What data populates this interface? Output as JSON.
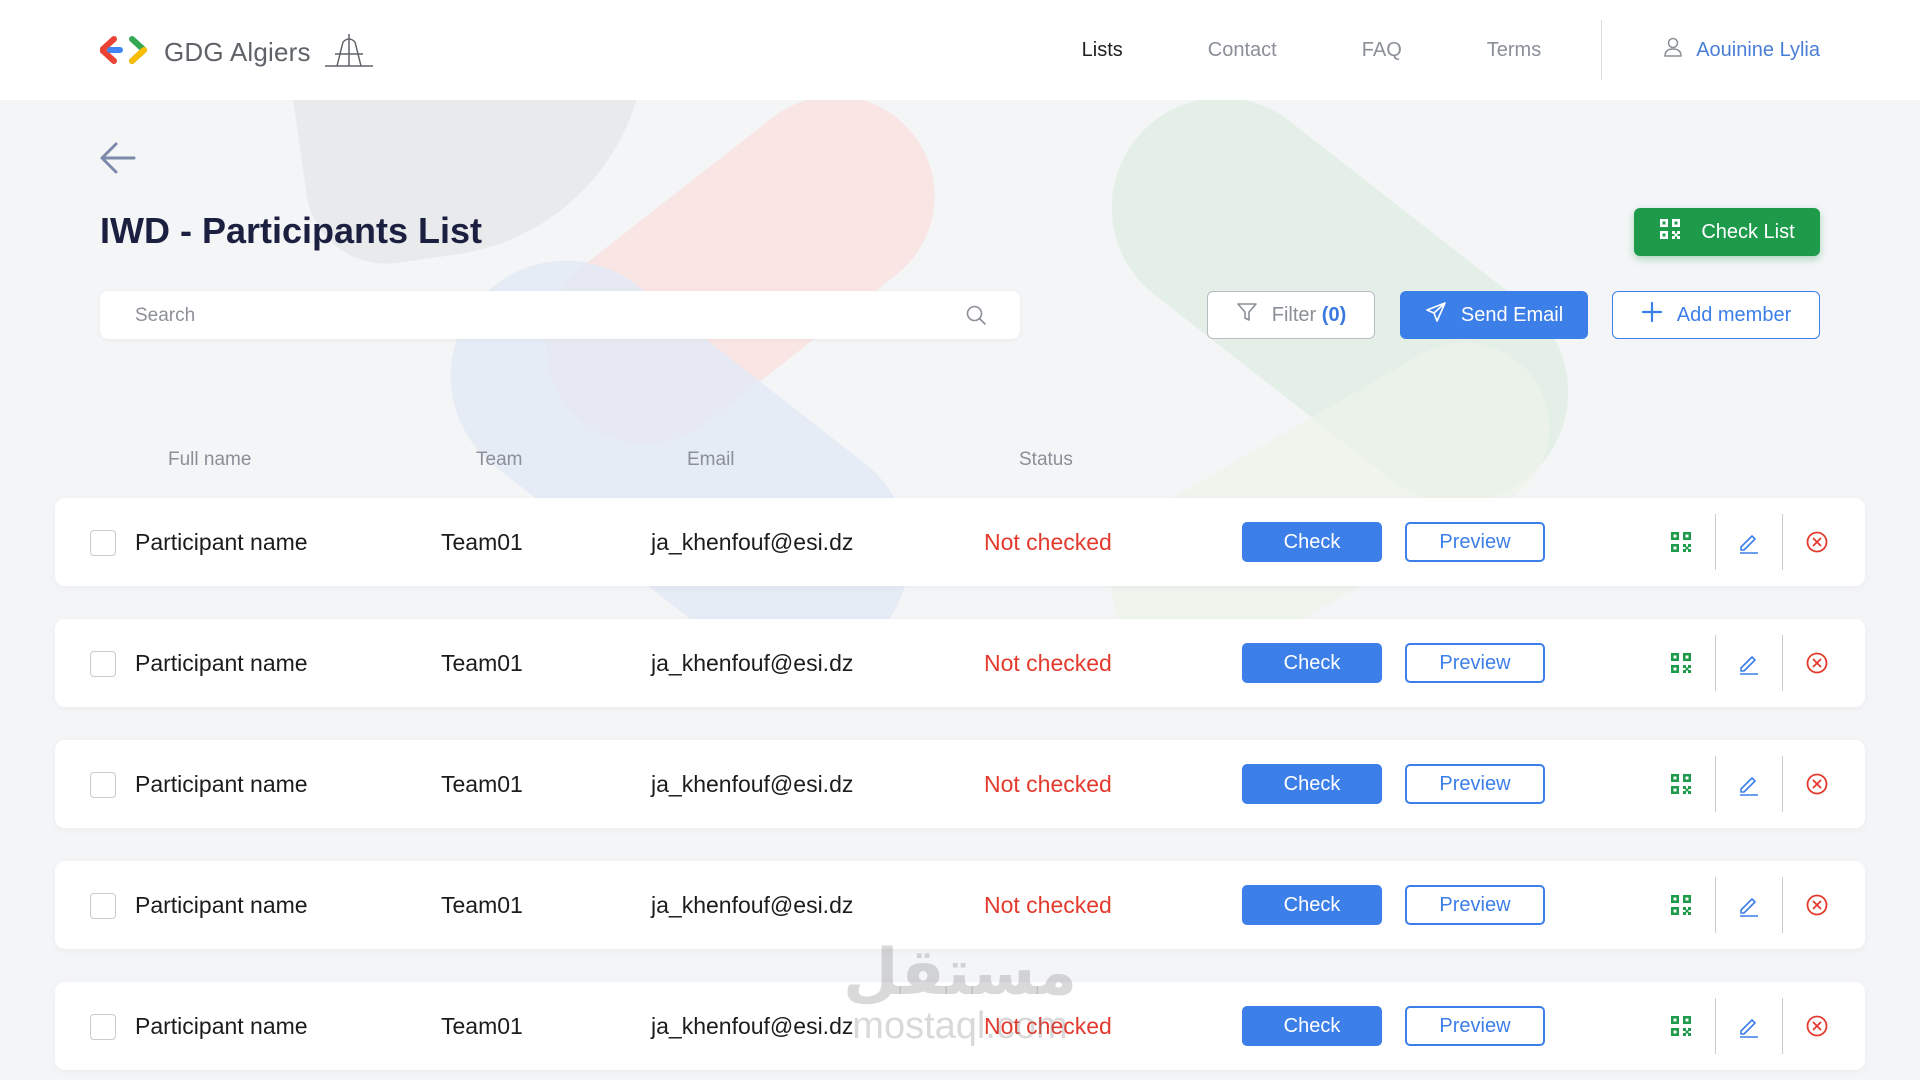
{
  "header": {
    "logo_text": "GDG Algiers",
    "nav": [
      {
        "label": "Lists",
        "active": true
      },
      {
        "label": "Contact",
        "active": false
      },
      {
        "label": "FAQ",
        "active": false
      },
      {
        "label": "Terms",
        "active": false
      }
    ],
    "user_name": "Aouinine Lylia"
  },
  "page": {
    "title": "IWD - Participants List",
    "check_list_label": "Check List"
  },
  "toolbar": {
    "search_placeholder": "Search",
    "filter_label": "Filter",
    "filter_count": "(0)",
    "send_email_label": "Send Email",
    "add_member_label": "Add member"
  },
  "table": {
    "columns": [
      "Full name",
      "Team",
      "Email",
      "Status"
    ],
    "check_label": "Check",
    "preview_label": "Preview",
    "rows": [
      {
        "name": "Participant name",
        "team": "Team01",
        "email": "ja_khenfouf@esi.dz",
        "status": "Not checked"
      },
      {
        "name": "Participant name",
        "team": "Team01",
        "email": "ja_khenfouf@esi.dz",
        "status": "Not checked"
      },
      {
        "name": "Participant name",
        "team": "Team01",
        "email": "ja_khenfouf@esi.dz",
        "status": "Not checked"
      },
      {
        "name": "Participant name",
        "team": "Team01",
        "email": "ja_khenfouf@esi.dz",
        "status": "Not checked"
      },
      {
        "name": "Participant name",
        "team": "Team01",
        "email": "ja_khenfouf@esi.dz",
        "status": "Not checked"
      }
    ]
  },
  "watermark": {
    "arabic": "مستقل",
    "latin": "mostaql.com"
  },
  "colors": {
    "primary_blue": "#3d7fe8",
    "success_green": "#1e9a4b",
    "status_red": "#e33a2d",
    "title_navy": "#1b2040"
  },
  "icons": {
    "logo": "gdg-chevrons-icon",
    "landmark": "maqam-echahid-icon",
    "user": "user-icon",
    "back": "arrow-left-icon",
    "search": "search-icon",
    "filter": "filter-icon",
    "send": "send-icon",
    "add": "plus-icon",
    "qr": "qr-code-icon",
    "edit": "pencil-icon",
    "delete": "close-circle-icon"
  }
}
